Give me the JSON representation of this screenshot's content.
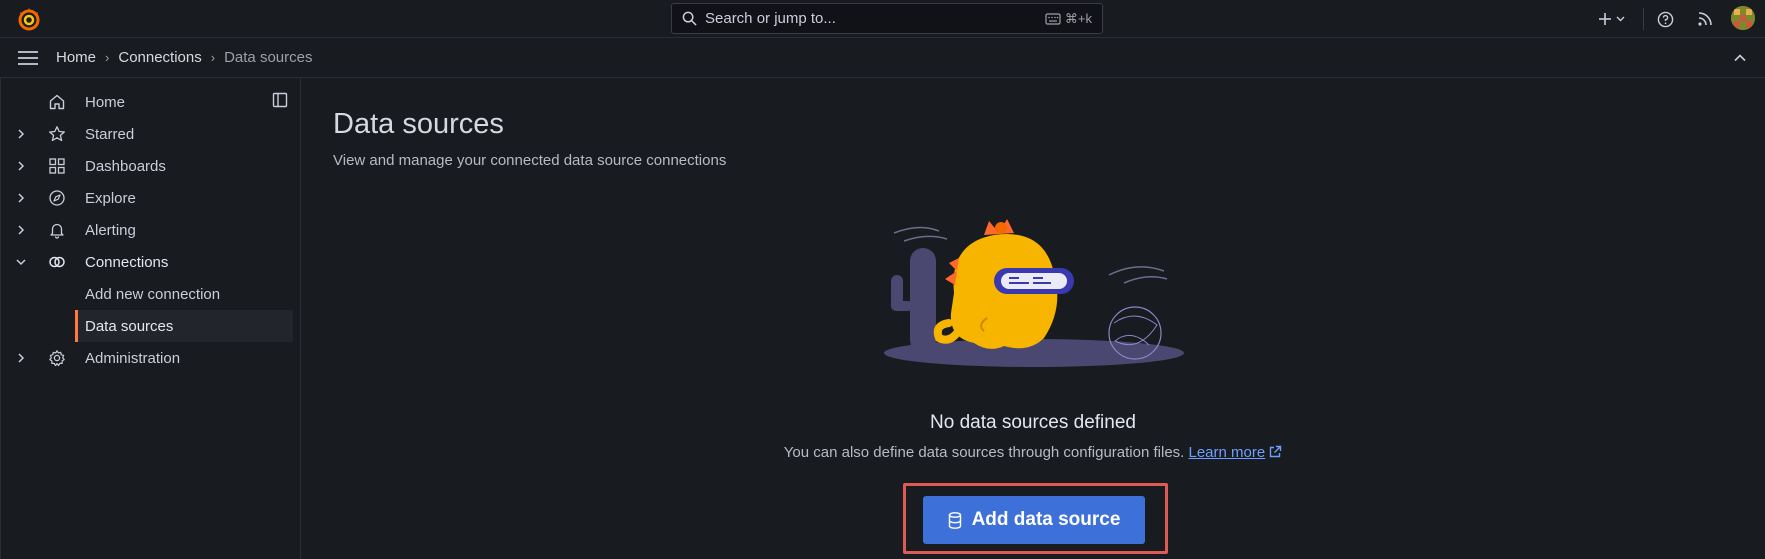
{
  "topbar": {
    "search_placeholder": "Search or jump to...",
    "search_shortcut": "⌘+k"
  },
  "breadcrumb": [
    "Home",
    "Connections",
    "Data sources"
  ],
  "sidebar": {
    "items": [
      {
        "label": "Home",
        "icon": "home-icon",
        "expandable": false
      },
      {
        "label": "Starred",
        "icon": "star-icon",
        "expandable": true
      },
      {
        "label": "Dashboards",
        "icon": "apps-icon",
        "expandable": true
      },
      {
        "label": "Explore",
        "icon": "compass-icon",
        "expandable": true
      },
      {
        "label": "Alerting",
        "icon": "bell-icon",
        "expandable": true
      },
      {
        "label": "Connections",
        "icon": "link-icon",
        "expandable": true,
        "expanded": true
      },
      {
        "label": "Administration",
        "icon": "cog-icon",
        "expandable": true
      }
    ],
    "connections_children": [
      {
        "label": "Add new connection",
        "selected": false
      },
      {
        "label": "Data sources",
        "selected": true
      }
    ]
  },
  "main": {
    "title": "Data sources",
    "subtitle": "View and manage your connected data source connections",
    "empty_title": "No data sources defined",
    "empty_desc": "You can also define data sources through configuration files.",
    "learn_more": "Learn more",
    "add_button": "Add data source"
  },
  "colors": {
    "background": "#181b1f",
    "accent_orange": "#ff7941",
    "primary_button": "#3d71d9",
    "highlight_red": "#e05a55",
    "link": "#6e9fff"
  }
}
